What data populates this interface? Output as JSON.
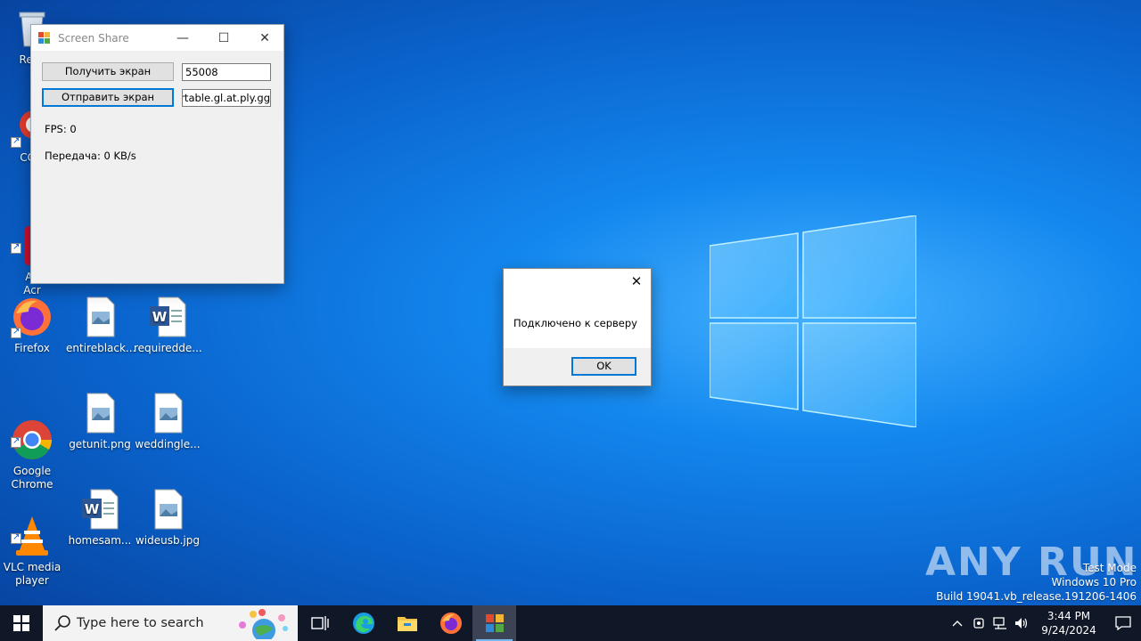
{
  "desktop": {
    "icons": [
      {
        "label": "Recy",
        "icon": "recycle-bin-icon"
      },
      {
        "label": "CCle",
        "icon": "ccleaner-icon"
      },
      {
        "label": "Ad\nAcr",
        "icon": "adobe-acrobat-icon"
      },
      {
        "label": "Firefox",
        "icon": "firefox-icon"
      },
      {
        "label": "entireblack...",
        "icon": "image-file-icon"
      },
      {
        "label": "requiredde...",
        "icon": "word-document-icon"
      },
      {
        "label": "Google\nChrome",
        "icon": "chrome-icon"
      },
      {
        "label": "getunit.png",
        "icon": "image-file-icon"
      },
      {
        "label": "weddingle...",
        "icon": "image-file-icon"
      },
      {
        "label": "VLC media\nplayer",
        "icon": "vlc-icon"
      },
      {
        "label": "homesam...",
        "icon": "word-document-icon"
      },
      {
        "label": "wideusb.jpg",
        "icon": "image-file-icon"
      }
    ]
  },
  "screen_share": {
    "title": "Screen Share",
    "receive_button": "Получить экран",
    "send_button": "Отправить экран",
    "port_value": "55008",
    "host_value": "nfortable.gl.at.ply.gg",
    "fps_label": "FPS: 0",
    "transfer_label": "Передача: 0 KB/s",
    "controls": {
      "minimize": "—",
      "maximize": "☐",
      "close": "✕"
    }
  },
  "message_box": {
    "text": "Подключено к серверу",
    "ok_button": "OK",
    "close": "✕"
  },
  "watermark": {
    "brand": "ANY RUN",
    "test_mode": "Test Mode",
    "edition": "Windows 10 Pro",
    "build": "Build 19041.vb_release.191206-1406"
  },
  "taskbar": {
    "search_placeholder": "Type here to search",
    "pinned": [
      "task-view-icon",
      "edge-icon",
      "file-explorer-icon",
      "firefox-icon",
      "screen-share-app-icon"
    ],
    "clock_time": "3:44 PM",
    "clock_date": "9/24/2024"
  },
  "colors": {
    "accent": "#0078d7",
    "taskbar": "#101726",
    "wallpaper": "#0a63cc"
  }
}
